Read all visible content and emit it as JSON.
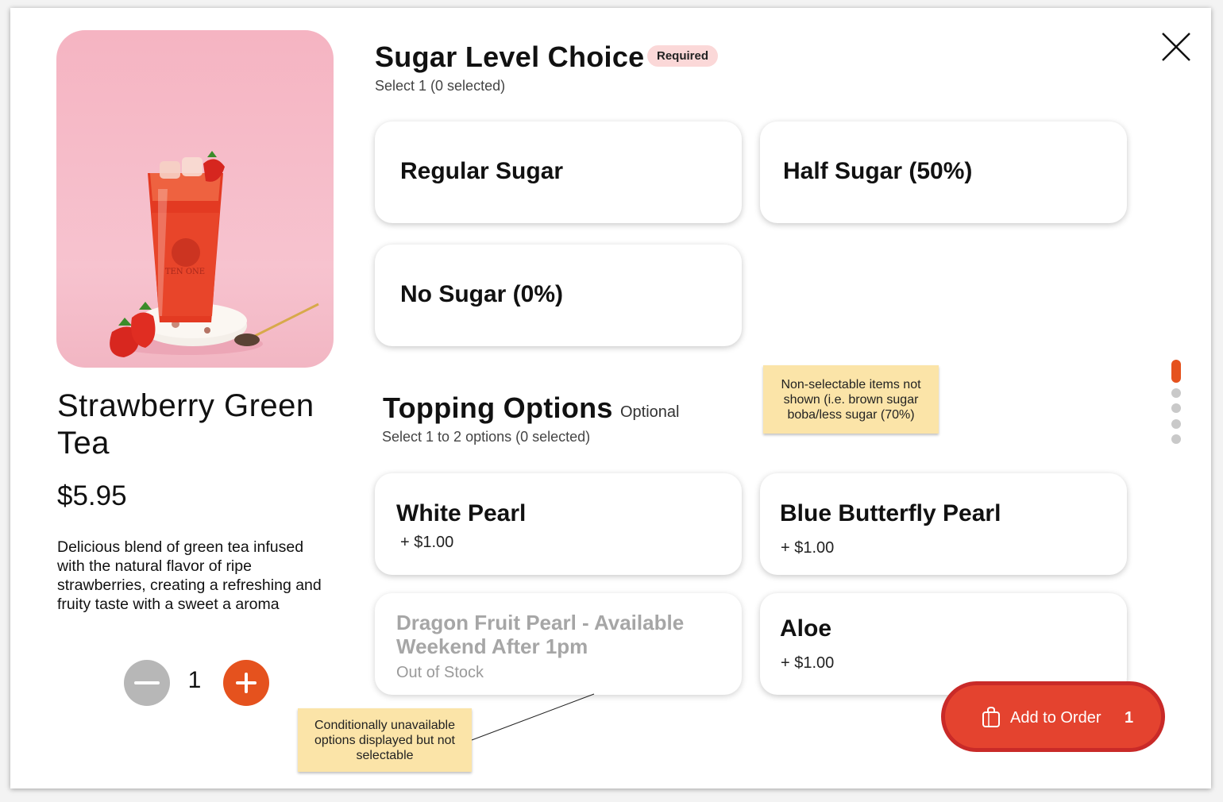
{
  "product": {
    "name": "Strawberry Green Tea",
    "price": "$5.95",
    "description": "Delicious blend of green tea infused with the natural flavor of ripe strawberries, creating a refreshing and fruity taste with a sweet a aroma",
    "image_alt": "Strawberry green tea drink",
    "cup_logo_text": "TEN ONE"
  },
  "quantity": {
    "value": "1"
  },
  "sugar_section": {
    "title": "Sugar Level Choice",
    "badge": "Required",
    "subtitle": "Select 1 (0 selected)",
    "options": [
      {
        "label": "Regular Sugar"
      },
      {
        "label": "Half Sugar (50%)"
      },
      {
        "label": "No Sugar (0%)"
      }
    ]
  },
  "topping_section": {
    "title": "Topping Options",
    "badge": "Optional",
    "subtitle": "Select 1 to 2 options (0 selected)",
    "options": [
      {
        "label": "White Pearl",
        "price": "+ $1.00"
      },
      {
        "label": "Blue Butterfly Pearl",
        "price": "+ $1.00"
      },
      {
        "label": "Dragon Fruit Pearl - Available Weekend After 1pm",
        "status": "Out of Stock"
      },
      {
        "label": "Aloe",
        "price": "+ $1.00"
      }
    ]
  },
  "notes": {
    "non_selectable": "Non-selectable items not shown (i.e. brown sugar boba/less sugar (70%)",
    "conditional": "Conditionally unavailable options displayed but not selectable"
  },
  "add_to_order": {
    "label": "Add to Order",
    "count": "1"
  },
  "colors": {
    "accent": "#e5521e",
    "button_red": "#e4432f",
    "badge_bg": "#fbd8d8",
    "note_bg": "#fbe4a8"
  },
  "icons": [
    "close-icon",
    "minus-icon",
    "plus-icon",
    "shopping-bag-icon"
  ]
}
